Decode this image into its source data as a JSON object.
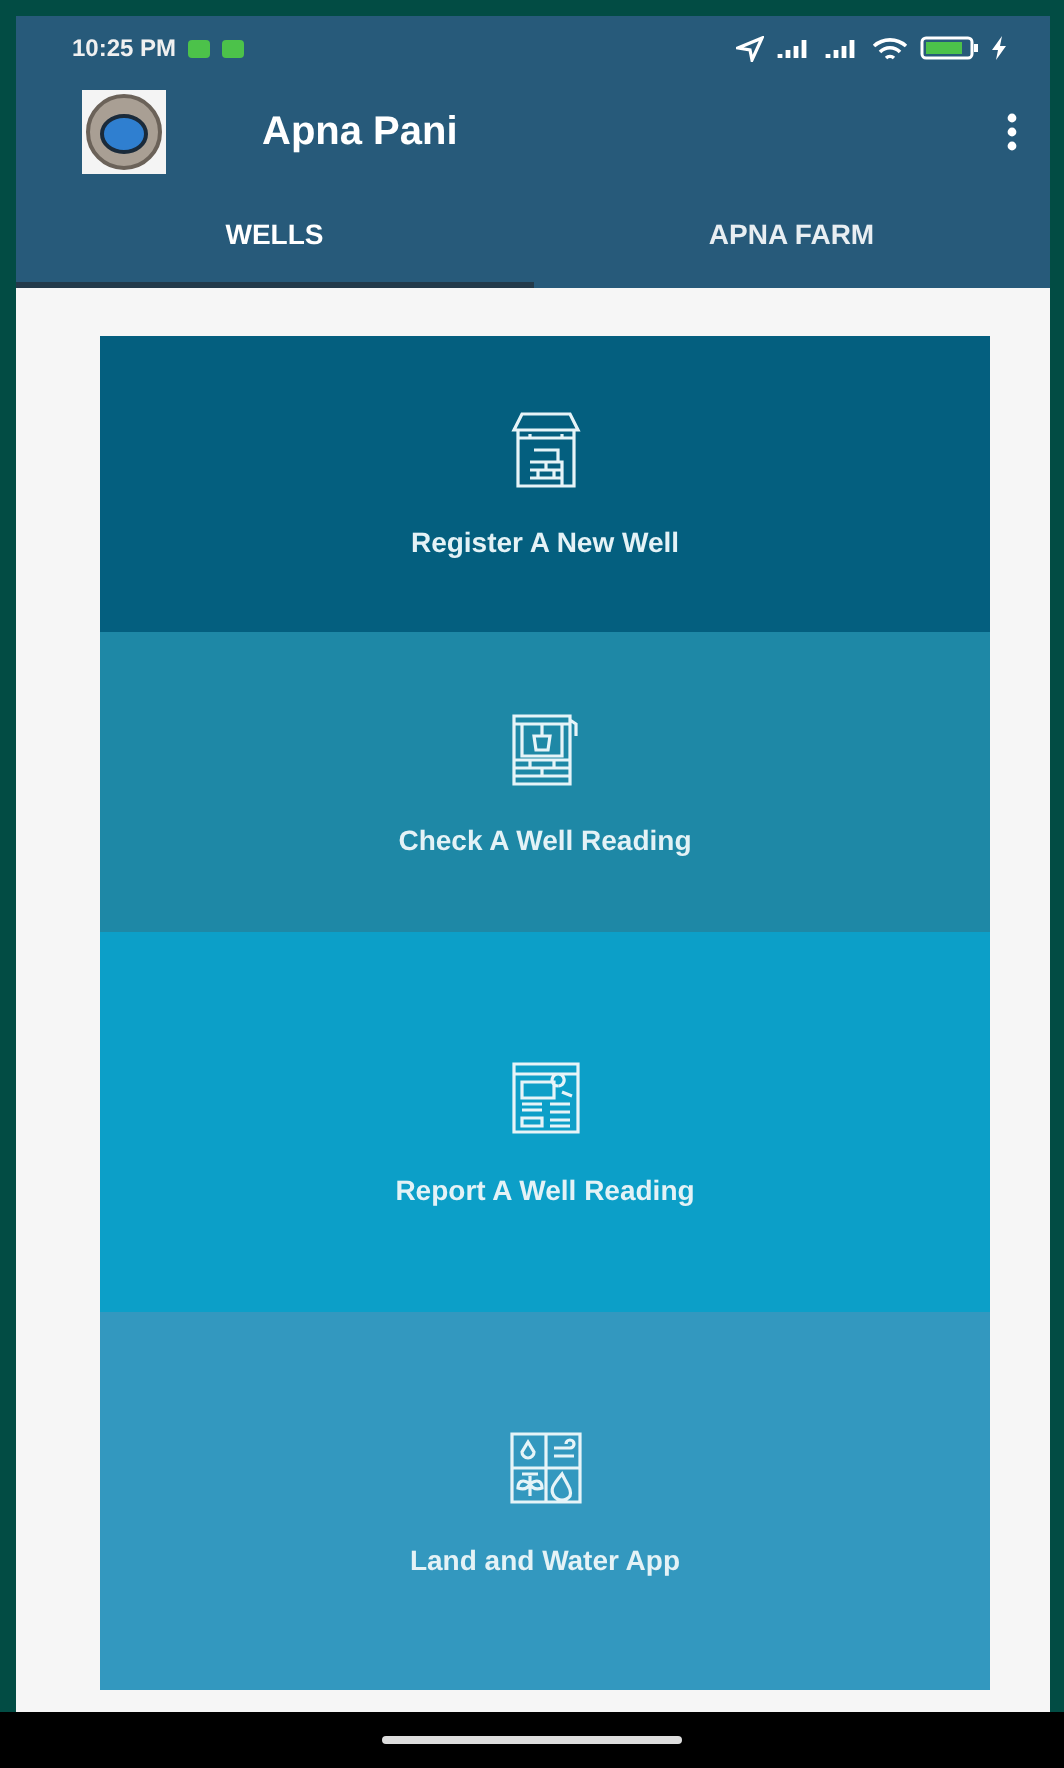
{
  "status_bar": {
    "time": "10:25 PM"
  },
  "app_bar": {
    "title": "Apna Pani"
  },
  "tabs": [
    {
      "label": "WELLS",
      "selected": true
    },
    {
      "label": "APNA FARM",
      "selected": false
    }
  ],
  "tiles": [
    {
      "label": "Register A New Well",
      "kind": "well",
      "color": "#045f7f"
    },
    {
      "label": "Check A Well Reading",
      "kind": "bucket",
      "color": "#1e88a6"
    },
    {
      "label": "Report A Well Reading",
      "kind": "report",
      "color": "#0c9fc8"
    },
    {
      "label": "Land and Water App",
      "kind": "land",
      "color": "#3398bf"
    }
  ]
}
